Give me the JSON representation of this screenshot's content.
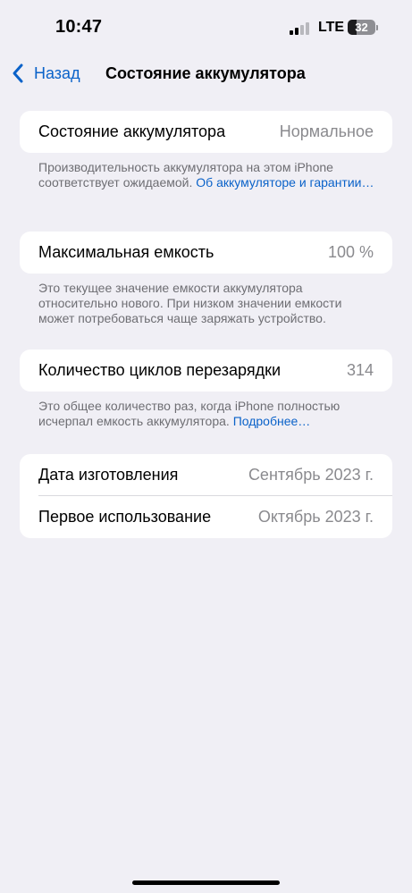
{
  "status_bar": {
    "time": "10:47",
    "network": "LTE",
    "battery_level": "32",
    "battery_fraction": 0.32,
    "signal_icon": "cellular-signal-icon"
  },
  "nav": {
    "back_label": "Назад",
    "title": "Состояние аккумулятора",
    "back_icon": "chevron-left-icon"
  },
  "health": {
    "label": "Состояние аккумулятора",
    "value": "Нормальное",
    "footnote": "Производительность аккумулятора на этом iPhone соответствует ожидаемой.",
    "link": "Об аккумуляторе и гарантии…"
  },
  "capacity": {
    "label": "Максимальная емкость",
    "value": "100 %",
    "footnote": "Это текущее значение емкости аккумулятора относительно нового. При низком значении емкости может потребоваться чаще заряжать устройство."
  },
  "cycles": {
    "label": "Количество циклов перезарядки",
    "value": "314",
    "footnote": "Это общее количество раз, когда iPhone полностью исчерпал емкость аккумулятора.",
    "link": "Подробнее…"
  },
  "dates": {
    "manufacture_label": "Дата изготовления",
    "manufacture_value": "Сентябрь 2023 г.",
    "first_use_label": "Первое использование",
    "first_use_value": "Октябрь 2023 г."
  },
  "colors": {
    "background": "#f0eff5",
    "accent": "#0a62c9",
    "secondary_text": "#8a8a8e"
  }
}
